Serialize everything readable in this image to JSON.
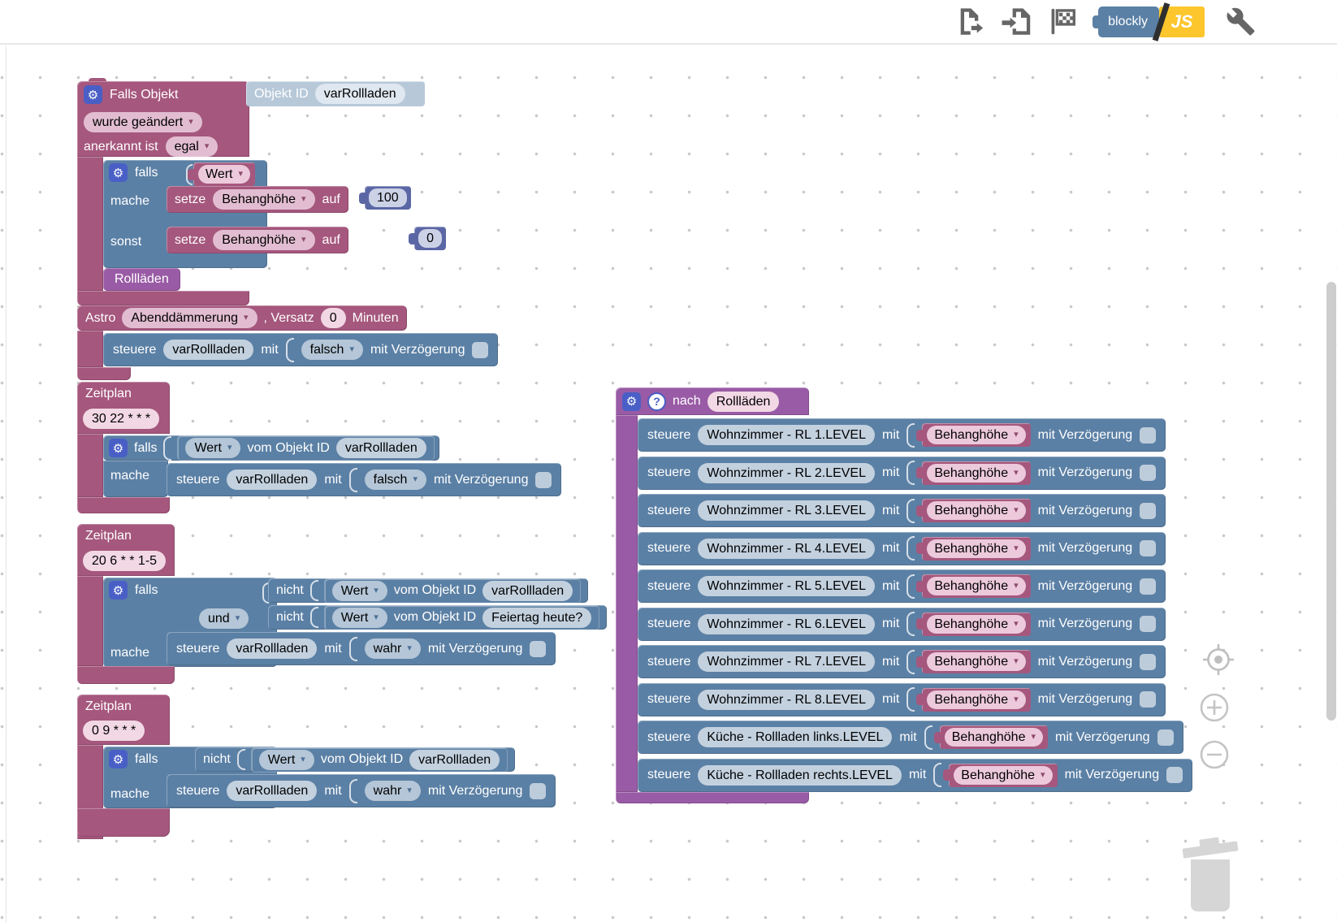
{
  "toolbar": {
    "logo_blockly": "blockly",
    "logo_js": "JS",
    "icons": [
      "export-blocks-icon",
      "import-blocks-icon",
      "check-blocks-flag-icon",
      "blockly-js-toggle",
      "settings-wrench-icon"
    ]
  },
  "icons": {
    "gear": "⚙",
    "help": "?",
    "dropdown_arrow": "▾"
  },
  "labels": {
    "falls": "falls",
    "mache": "mache",
    "sonst": "sonst",
    "setze": "setze",
    "auf": "auf",
    "steuere": "steuere",
    "mit": "mit",
    "mit_verzoegerung": "mit Verzögerung",
    "nicht": "nicht",
    "wert": "Wert",
    "vom_objekt_id": "vom Objekt ID",
    "astro": "Astro",
    "versatz": ", Versatz",
    "minuten": "Minuten",
    "zeitplan": "Zeitplan",
    "nach": "nach"
  },
  "falls_objekt": {
    "title": "Falls Objekt",
    "objekt_id_label": "Objekt ID",
    "objekt_id": "varRollladen",
    "trigger": "wurde geändert",
    "ack_label": "anerkannt ist",
    "ack": "egal",
    "condition": "Wert",
    "set_var": "Behanghöhe",
    "value_then": "100",
    "value_else": "0",
    "call": "Rollläden"
  },
  "astro": {
    "event": "Abenddämmerung",
    "offset": "0",
    "control": {
      "object": "varRollladen",
      "value": "falsch"
    }
  },
  "zeitplan1": {
    "cron": "30 22 * * *",
    "condition": {
      "select": "Wert",
      "object": "varRollladen"
    },
    "control": {
      "object": "varRollladen",
      "value": "falsch"
    }
  },
  "zeitplan2": {
    "cron": "20 6 * * 1-5",
    "operator": "und",
    "condition1": {
      "select": "Wert",
      "object": "varRollladen"
    },
    "condition2": {
      "select": "Wert",
      "object": "Feiertag heute?"
    },
    "control": {
      "object": "varRollladen",
      "value": "wahr"
    }
  },
  "zeitplan3": {
    "cron": "0 9 * * *",
    "condition": {
      "select": "Wert",
      "object": "varRollladen"
    },
    "control": {
      "object": "varRollladen",
      "value": "wahr"
    }
  },
  "func": {
    "name": "Rollläden",
    "rows": [
      {
        "object": "Wohnzimmer - RL 1.LEVEL",
        "value": "Behanghöhe"
      },
      {
        "object": "Wohnzimmer - RL 2.LEVEL",
        "value": "Behanghöhe"
      },
      {
        "object": "Wohnzimmer - RL 3.LEVEL",
        "value": "Behanghöhe"
      },
      {
        "object": "Wohnzimmer - RL 4.LEVEL",
        "value": "Behanghöhe"
      },
      {
        "object": "Wohnzimmer - RL 5.LEVEL",
        "value": "Behanghöhe"
      },
      {
        "object": "Wohnzimmer - RL 6.LEVEL",
        "value": "Behanghöhe"
      },
      {
        "object": "Wohnzimmer - RL 7.LEVEL",
        "value": "Behanghöhe"
      },
      {
        "object": "Wohnzimmer - RL 8.LEVEL",
        "value": "Behanghöhe"
      },
      {
        "object": "Küche - Rollladen links.LEVEL",
        "value": "Behanghöhe"
      },
      {
        "object": "Küche - Rollladen rechts.LEVEL",
        "value": "Behanghöhe"
      }
    ]
  },
  "colors": {
    "block_pink": "#a5577d",
    "block_blue": "#5b80a5",
    "block_purple": "#995ba5",
    "block_number_blue": "#5b67a5",
    "icon_square_blue": "#4a5fc6",
    "logo_blue": "#5b80a5",
    "logo_yellow": "#fcc62c",
    "field_light_blue": "#c3d1df",
    "field_light_pink": "#e2bdd1"
  }
}
